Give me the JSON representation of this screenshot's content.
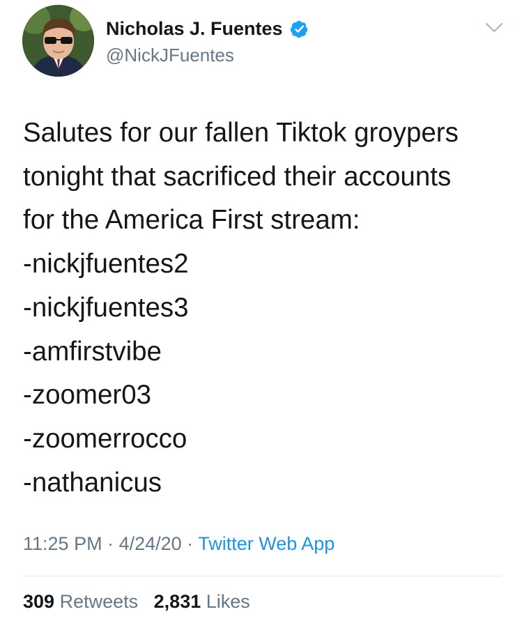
{
  "author": {
    "name": "Nicholas J. Fuentes",
    "handle": "@NickJFuentes",
    "verified": true
  },
  "tweet": {
    "lines": [
      "Salutes for our fallen Tiktok groypers",
      "tonight that sacrificed their accounts",
      "for the America First stream:",
      "-nickjfuentes2",
      "-nickjfuentes3",
      "-amfirstvibe",
      "-zoomer03",
      "-zoomerrocco",
      "-nathanicus"
    ]
  },
  "meta": {
    "time": "11:25 PM",
    "sep1": " · ",
    "date": "4/24/20",
    "sep2": " · ",
    "source": "Twitter Web App"
  },
  "stats": {
    "retweets_count": "309",
    "retweets_label": "Retweets",
    "likes_count": "2,831",
    "likes_label": "Likes"
  },
  "icons": {
    "avatar": "profile-photo",
    "verified": "verified-badge-icon",
    "menu": "chevron-down-icon"
  },
  "colors": {
    "text": "#14171a",
    "secondary": "#657786",
    "link": "#1b95e0",
    "verified": "#1da1f2",
    "divider": "#e1e8ed"
  }
}
